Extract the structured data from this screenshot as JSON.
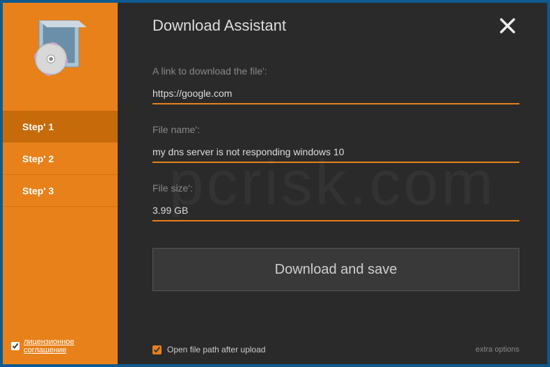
{
  "header": {
    "title": "Download Assistant"
  },
  "sidebar": {
    "steps": [
      {
        "label": "Step' 1",
        "active": true
      },
      {
        "label": "Step' 2",
        "active": false
      },
      {
        "label": "Step' 3",
        "active": false
      }
    ],
    "license": {
      "checked": true,
      "label": "лицензионное соглашение"
    }
  },
  "fields": {
    "link": {
      "label": "A link to download the file':",
      "value": "https://google.com"
    },
    "filename": {
      "label": "File name':",
      "value": "my dns server is not responding windows 10"
    },
    "filesize": {
      "label": "File size':",
      "value": "3.99 GB"
    }
  },
  "actions": {
    "download_label": "Download and save"
  },
  "footer": {
    "open_path_label": "Open file path after upload",
    "open_path_checked": true,
    "extra_options_label": "extra options"
  }
}
